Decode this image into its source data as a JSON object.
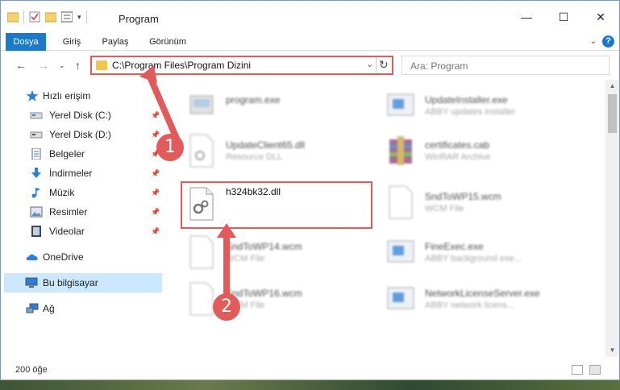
{
  "window": {
    "title": "Program",
    "min_glyph": "—",
    "max_glyph": "☐",
    "close_glyph": "✕"
  },
  "ribbon": {
    "tabs": [
      "Dosya",
      "Giriş",
      "Paylaş",
      "Görünüm"
    ],
    "help": "?"
  },
  "address": {
    "path": "C:\\Program Files\\Program Dizini",
    "search_placeholder": "Ara: Program"
  },
  "sidebar": {
    "items": [
      {
        "label": "Hızlı erişim",
        "icon": "star-icon"
      },
      {
        "label": "Yerel Disk (C:)",
        "icon": "drive-icon"
      },
      {
        "label": "Yerel Disk (D:)",
        "icon": "drive-icon"
      },
      {
        "label": "Belgeler",
        "icon": "documents-icon"
      },
      {
        "label": "İndirmeler",
        "icon": "download-icon"
      },
      {
        "label": "Müzik",
        "icon": "music-icon"
      },
      {
        "label": "Resimler",
        "icon": "pictures-icon"
      },
      {
        "label": "Videolar",
        "icon": "videos-icon"
      },
      {
        "label": "OneDrive",
        "icon": "cloud-icon"
      },
      {
        "label": "Bu bilgisayar",
        "icon": "computer-icon"
      },
      {
        "label": "Ağ",
        "icon": "network-icon"
      }
    ]
  },
  "files": [
    {
      "name": "program.exe",
      "desc": ""
    },
    {
      "name": "UpdateInstaller.exe",
      "desc": "ABBY updates installer"
    },
    {
      "name": "UpdateClient65.dll",
      "desc": "Resource DLL"
    },
    {
      "name": "certificates.cab",
      "desc": "WinRAR Archive"
    },
    {
      "name": "h324bk32.dll",
      "desc": ""
    },
    {
      "name": "SndToWP15.wcm",
      "desc": "WCM File"
    },
    {
      "name": "SndToWP14.wcm",
      "desc": "WCM File"
    },
    {
      "name": "FineExec.exe",
      "desc": "ABBY background exe..."
    },
    {
      "name": "SndToWP16.wcm",
      "desc": "WCM File"
    },
    {
      "name": "NetworkLicenseServer.exe",
      "desc": "ABBY network licens..."
    }
  ],
  "callouts": {
    "one": "1",
    "two": "2"
  },
  "status": {
    "count": "200 öğe"
  },
  "colors": {
    "accent": "#1979ca",
    "highlight": "#e25a5a",
    "selected": "#cce8ff"
  }
}
